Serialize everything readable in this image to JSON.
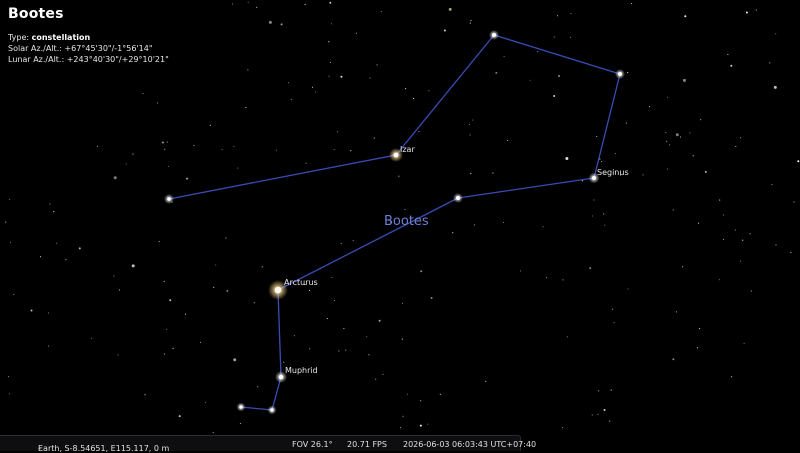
{
  "object": {
    "title": "Bootes",
    "type_label": "Type:",
    "type_value": "constellation",
    "solar_label": "Solar Az./Alt.:",
    "solar_value": "+67°45'30\"/-1°56'14\"",
    "lunar_label": "Lunar Az./Alt.:",
    "lunar_value": "+243°40'30\"/+29°10'21\""
  },
  "constellation": {
    "name": "Bootes",
    "line_color": "#3a4bb5",
    "label_color": "#6f7fd6"
  },
  "star_labels": {
    "izar": "Izar",
    "seginus": "Seginus",
    "arcturus": "Arcturus",
    "muphrid": "Muphrid"
  },
  "status_bar": {
    "location": "Earth, S-8.54651, E115.117, 0 m",
    "location_suffix": "-",
    "fov": "FOV 26.1°",
    "fps": "20.71 FPS",
    "datetime": "2026-06-03 06:03:43 UTC+07:40"
  },
  "colors": {
    "sky": "#000000",
    "status_bg": "#0e0e10"
  }
}
